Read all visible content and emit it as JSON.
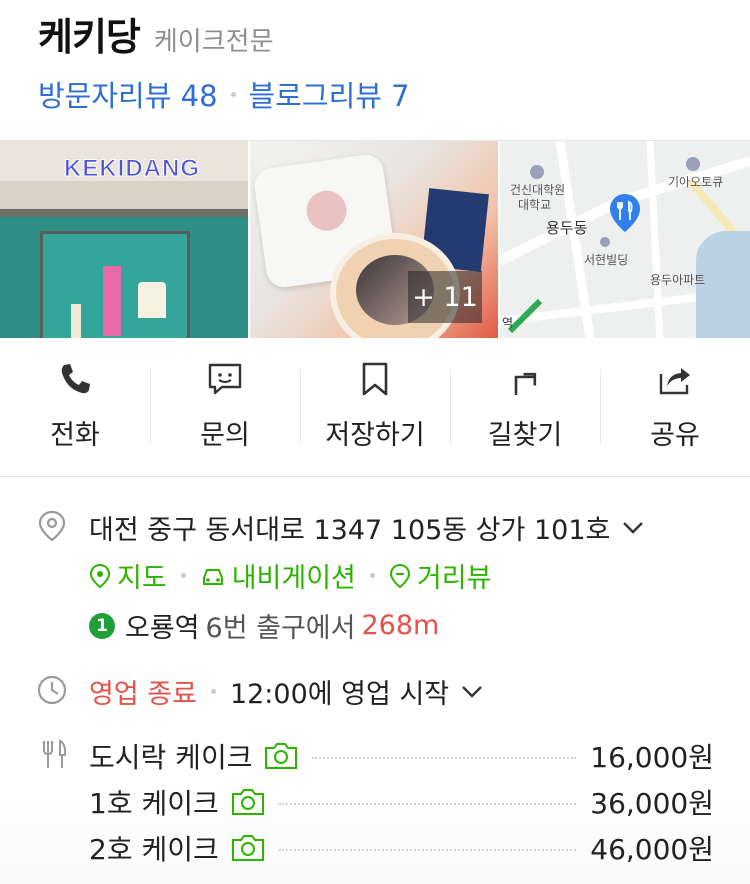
{
  "place": {
    "name": "케키당",
    "category": "케이크전문",
    "visitor_reviews": "방문자리뷰 48",
    "blog_reviews": "블로그리뷰 7"
  },
  "photos": {
    "sign_text": "KEKIDANG",
    "more_count": "+ 11",
    "map": {
      "labels": [
        "건신대학원",
        "대학교",
        "기아오토큐",
        "용두동",
        "서현빌딩",
        "용두아파트"
      ],
      "station_marker": "역"
    }
  },
  "actions": [
    {
      "label": "전화",
      "icon": "phone-icon"
    },
    {
      "label": "문의",
      "icon": "chat-icon"
    },
    {
      "label": "저장하기",
      "icon": "bookmark-icon"
    },
    {
      "label": "길찾기",
      "icon": "directions-icon"
    },
    {
      "label": "공유",
      "icon": "share-icon"
    }
  ],
  "info": {
    "address": "대전 중구 동서대로 1347 105동 상가 101호",
    "links": {
      "map": "지도",
      "navigation": "내비게이션",
      "street_view": "거리뷰"
    },
    "subway": {
      "line_number": "1",
      "station": "오룡역",
      "exit": "6번 출구에서",
      "distance": "268m"
    },
    "hours": {
      "status": "영업 종료",
      "next_open": "12:00에 영업 시작"
    }
  },
  "menu": [
    {
      "name": "도시락 케이크",
      "price": "16,000원"
    },
    {
      "name": "1호 케이크",
      "price": "36,000원"
    },
    {
      "name": "2호 케이크",
      "price": "46,000원"
    }
  ],
  "colors": {
    "accent_blue": "#2f6fd1",
    "naver_green": "#2db400",
    "closed_red": "#e5514b",
    "map_pin_blue": "#2f80ed",
    "subway_line1": "#1f9f37"
  }
}
